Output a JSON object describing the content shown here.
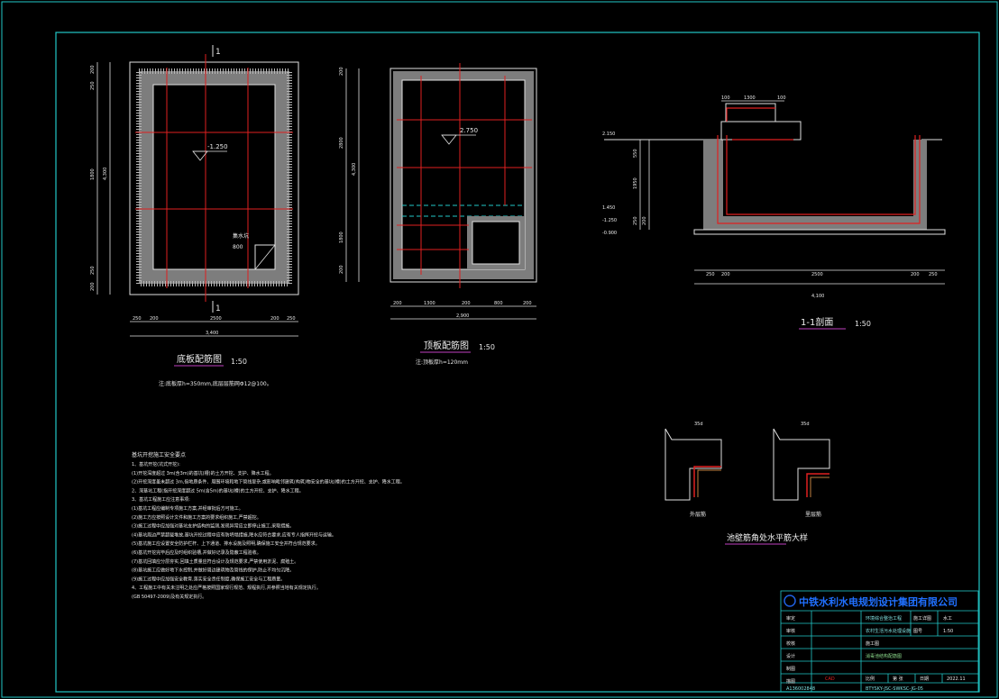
{
  "colors": {
    "background": "#000000",
    "frame": "#22c8c8",
    "concrete": "#c8c8c8",
    "rebar": "#e02020",
    "dimension": "#e8e8e8",
    "titleblock": "#22c8c8",
    "caption_underline": "#c040c0"
  },
  "plan_bottom": {
    "section_mark_top": "1",
    "section_mark_bottom": "1",
    "elevation": "-1.250",
    "pit_label": "集水坑",
    "pit_size": "800",
    "dims_left": [
      "200",
      "250",
      "1800",
      "250",
      "200",
      "4,300"
    ],
    "dims_bottom": [
      "250",
      "200",
      "2500",
      "200",
      "250"
    ],
    "dims_bottom_total": "3,400",
    "caption": "底板配筋图",
    "scale": "1:50",
    "note": "注:底板厚h=350mm,底层层筋网Φ12@100。"
  },
  "plan_top": {
    "elevation": "2.750",
    "dims_left": [
      "200",
      "2800",
      "1800",
      "200",
      "4,300"
    ],
    "dims_bottom": [
      "200",
      "1300",
      "200",
      "800",
      "200"
    ],
    "dims_bottom_total": "2,900",
    "caption": "顶板配筋图",
    "scale": "1:50",
    "note": "注:顶板厚h=120mm"
  },
  "section": {
    "elevations": [
      "2.150",
      "1.450",
      "-1.250",
      "-0.900"
    ],
    "dims_top": [
      "100",
      "1300",
      "100"
    ],
    "dims_bottom": [
      "250",
      "200",
      "2500",
      "200",
      "250"
    ],
    "dims_bottom_total": "4,100",
    "dims_left": [
      "550",
      "1950",
      "250",
      "200"
    ],
    "caption": "1-1剖面",
    "scale": "1:50"
  },
  "detail": {
    "dim_left": "35d",
    "dim_right": "35d",
    "label_left": "外层筋",
    "label_right": "里层筋",
    "caption": "池壁筋角处水平筋大样"
  },
  "notes": {
    "title": "基坑开挖施工安全要点",
    "lines": [
      "1、基坑开挖(坑式开挖):",
      "(1)开挖深度超过 3m(含3m)的基坑(槽)的土方开挖、支护、降水工程。",
      "(2)开挖深度虽未超过 3m,但地质条件、周围环境和地下管线复杂,或影响毗邻建筑(构筑)物安全的基坑(槽)的土方开挖、支护、降水工程。",
      "2、深基坑工程(指开挖深度超过 5m(含5m)的基坑(槽)的土方开挖、支护、降水工程。",
      "3、基坑工程施工应注意事项:",
      "(1)基坑工程应编制专项施工方案,并经审批后方可施工。",
      "(2)施工方应按照设计文件和施工方案的要求组织施工,严禁超挖。",
      "(3)施工过程中应加强对基坑支护结构的监测,发现异常应立即停止施工,采取措施。",
      "(4)基坑周边严禁超载堆放,基坑开挖过程中应有防坍塌措施,降水应符合要求,应有专人指挥开挖与运输。",
      "(5)基坑施工应设置安全防护栏杆、上下通道、排水设施及照明,确保施工安全并符合规范要求。",
      "(6)基坑开挖完毕后应及时组织验槽,并做好记录及隐蔽工程验收。",
      "(7)基坑回填应分层夯实,回填土质量应符合设计及规范要求,严禁使用淤泥、腐殖土。",
      "(8)基坑施工应做好地下水控制,并做好周边建筑物及管线的保护,防止不均匀沉降。",
      "(9)施工过程中应加强安全教育,落实安全责任制度,确保施工安全与工程质量。",
      "4、工程施工中有关未注明之处应严格按照国家现行规范、规程执行,并参照当地有关规定执行。",
      "(GB 50497-2009)及有关规定执行。"
    ]
  },
  "titleblock": {
    "company": "中铁水利水电规划设计集团有限公司",
    "row_labels": [
      "审定",
      "审核",
      "校核",
      "设计",
      "制图",
      "描图"
    ],
    "project": "环境综合整治工程",
    "subproject": "农村生活污水处理设施",
    "drawing_title": "消毒池结构配筋图",
    "phase_label": "施工图",
    "fields": {
      "stage": "施工详图",
      "discipline": "水工",
      "scale_label": "比例",
      "scale_value": "1:50",
      "sheet_label": "图号",
      "date_label": "日期",
      "date_value": "2022.11",
      "part_label": "第 张",
      "sheet_no": "BTYSKY-JSC-SWKSC-JG-05",
      "cert_no": "A136002848",
      "logo_text": "CAD"
    }
  }
}
